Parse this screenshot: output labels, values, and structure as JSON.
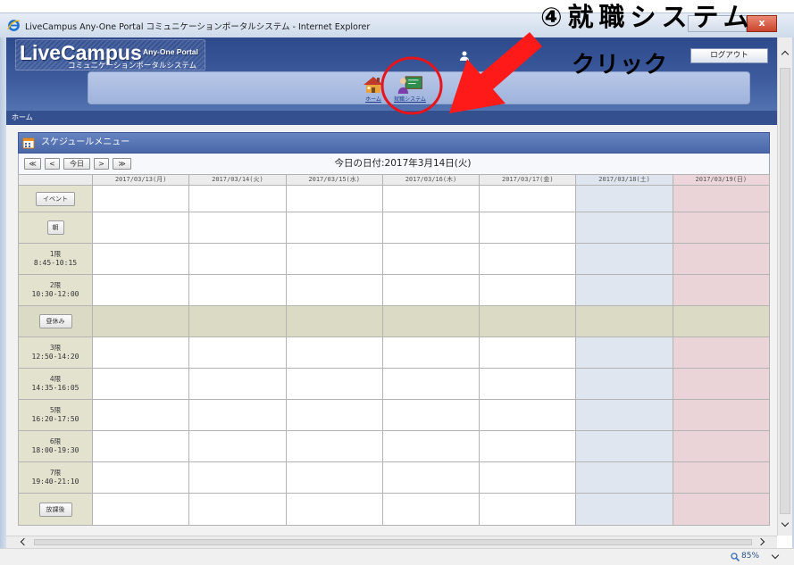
{
  "window": {
    "title": "LiveCampus Any-One Portal コミュニケーションポータルシステム - Internet Explorer",
    "app_icon": "internet-explorer-icon",
    "close_label": "x"
  },
  "annotation": {
    "step_label": "④就職システム",
    "action_label": "クリック",
    "color": "#ff1a1a"
  },
  "header": {
    "logo_main": "LiveCampus",
    "logo_sub": "Any-One Portal",
    "logo_tagline": "コミュニケーションポータルシステム",
    "user_icon": "user-icon",
    "logout_label": "ログアウト"
  },
  "nav": {
    "items": [
      {
        "label": "ホーム",
        "icon": "home-icon"
      },
      {
        "label": "就職システム",
        "icon": "job-system-icon"
      }
    ]
  },
  "breadcrumb": {
    "current": "ホーム"
  },
  "schedule": {
    "title": "スケジュールメニュー",
    "icon": "schedule-icon",
    "nav_buttons": {
      "first": "≪",
      "prev": "<",
      "today": "今日",
      "next": ">",
      "last": "≫"
    },
    "today_label": "今日の日付:2017年3月14日(火)",
    "dates": [
      "2017/03/13(月)",
      "2017/03/14(火)",
      "2017/03/15(水)",
      "2017/03/16(木)",
      "2017/03/17(金)",
      "2017/03/18(土)",
      "2017/03/19(日)"
    ],
    "rows": [
      {
        "label": "イベント"
      },
      {
        "label": "朝"
      },
      {
        "label": "1限",
        "time": "8:45-10:15"
      },
      {
        "label": "2限",
        "time": "10:30-12:00"
      },
      {
        "label": "昼休み"
      },
      {
        "label": "3限",
        "time": "12:50-14:20"
      },
      {
        "label": "4限",
        "time": "14:35-16:05"
      },
      {
        "label": "5限",
        "time": "16:20-17:50"
      },
      {
        "label": "6限",
        "time": "18:00-19:30"
      },
      {
        "label": "7限",
        "time": "19:40-21:10"
      },
      {
        "label": "放課後"
      }
    ]
  },
  "scrollbars": {
    "up_icon": "chevron-up-icon",
    "down_icon": "chevron-down-icon",
    "left_icon": "chevron-left-icon",
    "right_icon": "chevron-right-icon"
  },
  "status_bar": {
    "zoom": "85%",
    "zoom_icon": "magnifier-icon",
    "dropdown_icon": "chevron-down-icon"
  },
  "colors": {
    "header_blue": "#3a589a",
    "panel_blue": "#5574b3",
    "nav_panel": "#a9bce2",
    "period_column": "#e2e2cf",
    "lunch_row": "#dadac5",
    "saturday": "#dfe6ef",
    "sunday": "#ebd4d7",
    "annotation_red": "#ff1a1a"
  }
}
